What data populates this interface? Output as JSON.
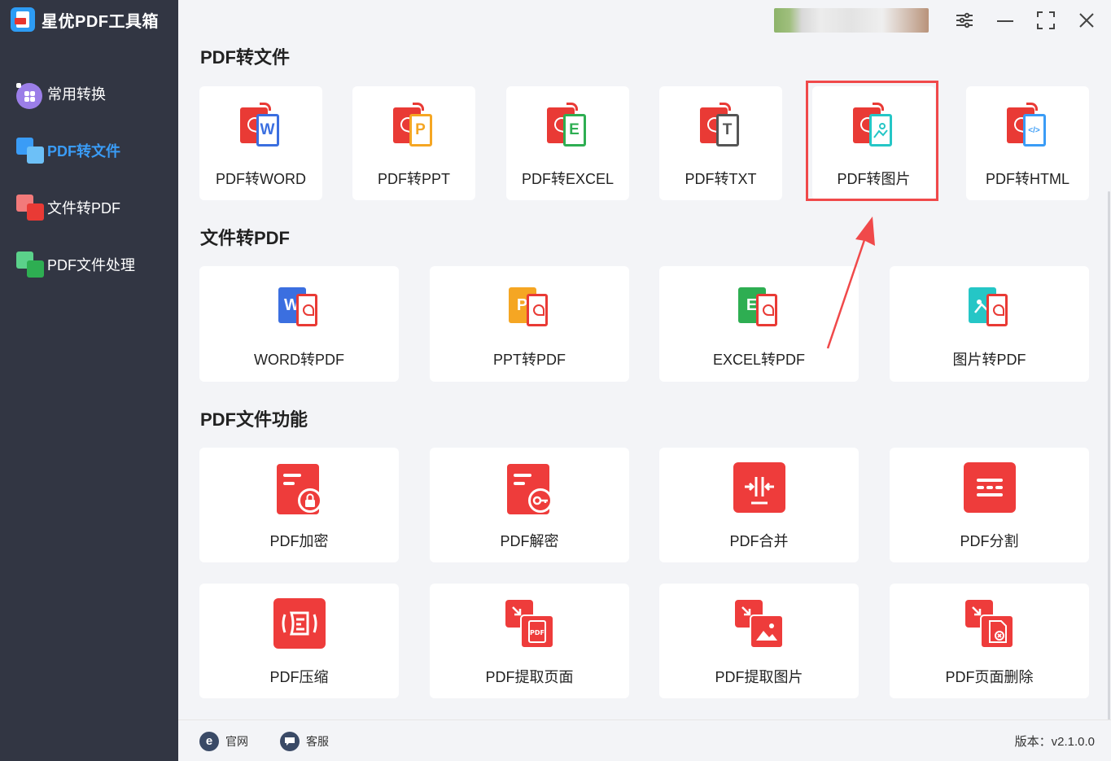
{
  "app": {
    "title": "星优PDF工具箱"
  },
  "sidebar": {
    "items": [
      {
        "label": "常用转换",
        "active": false
      },
      {
        "label": "PDF转文件",
        "active": true
      },
      {
        "label": "文件转PDF",
        "active": false
      },
      {
        "label": "PDF文件处理",
        "active": false
      }
    ]
  },
  "sections": {
    "pdf_to_file": {
      "title": "PDF转文件",
      "cards": [
        {
          "label": "PDF转WORD",
          "letter": "W",
          "color": "#3b6fe0"
        },
        {
          "label": "PDF转PPT",
          "letter": "P",
          "color": "#f5a623"
        },
        {
          "label": "PDF转EXCEL",
          "letter": "E",
          "color": "#2eae52"
        },
        {
          "label": "PDF转TXT",
          "letter": "T",
          "color": "#555555"
        },
        {
          "label": "PDF转图片",
          "letter": "",
          "color": "#25c6c6",
          "highlighted": true
        },
        {
          "label": "PDF转HTML",
          "letter": "</>",
          "color": "#3a9cf6"
        }
      ]
    },
    "file_to_pdf": {
      "title": "文件转PDF",
      "cards": [
        {
          "label": "WORD转PDF",
          "letter": "W",
          "color": "#3b6fe0"
        },
        {
          "label": "PPT转PDF",
          "letter": "P",
          "color": "#f5a623"
        },
        {
          "label": "EXCEL转PDF",
          "letter": "E",
          "color": "#2eae52"
        },
        {
          "label": "图片转PDF",
          "letter": "",
          "color": "#25c6c6"
        }
      ]
    },
    "pdf_functions": {
      "title": "PDF文件功能",
      "cards": [
        {
          "label": "PDF加密"
        },
        {
          "label": "PDF解密"
        },
        {
          "label": "PDF合并"
        },
        {
          "label": "PDF分割"
        },
        {
          "label": "PDF压缩"
        },
        {
          "label": "PDF提取页面"
        },
        {
          "label": "PDF提取图片"
        },
        {
          "label": "PDF页面删除"
        }
      ]
    }
  },
  "footer": {
    "website_label": "官网",
    "service_label": "客服",
    "version": "版本：v2.1.0.0"
  },
  "colors": {
    "accent": "#3a9cf6",
    "brand_red": "#ee3c3b",
    "sidebar_bg": "#323643",
    "highlight": "#f0494a"
  }
}
